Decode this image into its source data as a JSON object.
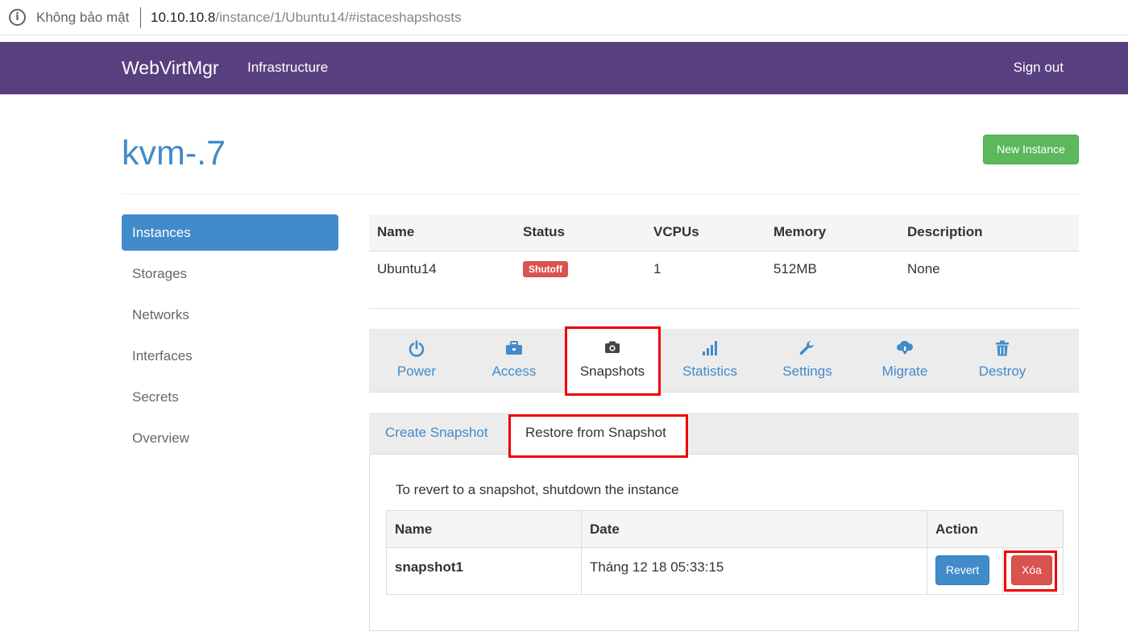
{
  "browser": {
    "security_label": "Không bảo mật",
    "url_host": "10.10.10.8",
    "url_path": "/instance/1/Ubuntu14/#istaceshapshosts"
  },
  "navbar": {
    "brand": "WebVirtMgr",
    "infrastructure": "Infrastructure",
    "sign_out": "Sign out"
  },
  "header": {
    "title": "kvm-.7",
    "new_instance": "New Instance"
  },
  "sidebar": {
    "items": [
      {
        "label": "Instances",
        "active": true
      },
      {
        "label": "Storages"
      },
      {
        "label": "Networks"
      },
      {
        "label": "Interfaces"
      },
      {
        "label": "Secrets"
      },
      {
        "label": "Overview"
      }
    ]
  },
  "instance_table": {
    "headers": [
      "Name",
      "Status",
      "VCPUs",
      "Memory",
      "Description"
    ],
    "row": {
      "name": "Ubuntu14",
      "status": "Shutoff",
      "vcpus": "1",
      "memory": "512MB",
      "description": "None"
    }
  },
  "action_tabs": [
    {
      "label": "Power",
      "icon": "power-icon"
    },
    {
      "label": "Access",
      "icon": "briefcase-icon"
    },
    {
      "label": "Snapshots",
      "icon": "camera-icon",
      "active": true
    },
    {
      "label": "Statistics",
      "icon": "signal-bars-icon"
    },
    {
      "label": "Settings",
      "icon": "wrench-icon"
    },
    {
      "label": "Migrate",
      "icon": "cloud-download-icon"
    },
    {
      "label": "Destroy",
      "icon": "trash-icon"
    }
  ],
  "snapshot_tabs": {
    "create": "Create Snapshot",
    "restore": "Restore from Snapshot"
  },
  "restore_panel": {
    "note": "To revert to a snapshot, shutdown the instance",
    "headers": [
      "Name",
      "Date",
      "Action"
    ],
    "rows": [
      {
        "name": "snapshot1",
        "date": "Tháng 12 18 05:33:15",
        "revert": "Revert",
        "delete": "Xóa"
      }
    ]
  },
  "colors": {
    "navbar": "#583f7e",
    "primary": "#428bca",
    "success": "#5cb85c",
    "danger": "#d9534f",
    "highlight": "#ee0000"
  }
}
